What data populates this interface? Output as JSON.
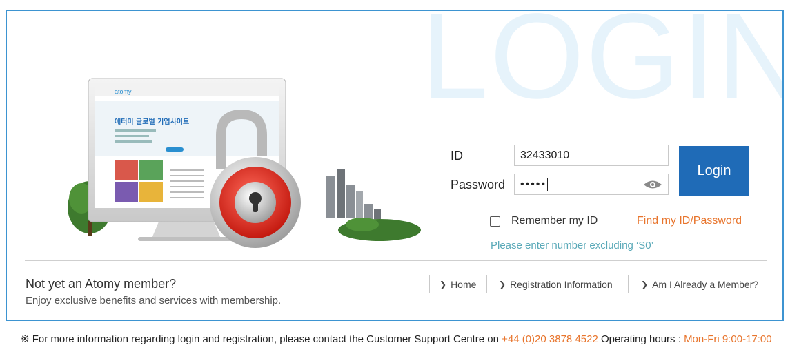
{
  "watermark": "LOGIN",
  "form": {
    "id_label": "ID",
    "id_value": "32433010",
    "password_label": "Password",
    "password_value": "•••••",
    "login_button": "Login",
    "remember_label": "Remember my ID",
    "find_link": "Find my ID/Password",
    "hint": "Please enter number excluding ‘S0’"
  },
  "member": {
    "title": "Not yet an Atomy member?",
    "subtitle": "Enjoy exclusive benefits and services with membership.",
    "links": [
      "Home",
      "Registration Information",
      "Am I Already a Member?"
    ]
  },
  "footer": {
    "prefix": "※ For more information regarding login and registration, please contact the Customer Support Centre on",
    "phone": "+44 (0)20 3878 4522",
    "hours_label": "Operating hours :",
    "hours": "Mon-Fri 9:00-17:00"
  },
  "illustration": {
    "brand": "atomy",
    "headline": "애터미 글로벌 기업사이트"
  },
  "colors": {
    "accent": "#1f6bb7",
    "border": "#3d94d1",
    "link": "#e8752d",
    "hint": "#5aa9b8"
  }
}
